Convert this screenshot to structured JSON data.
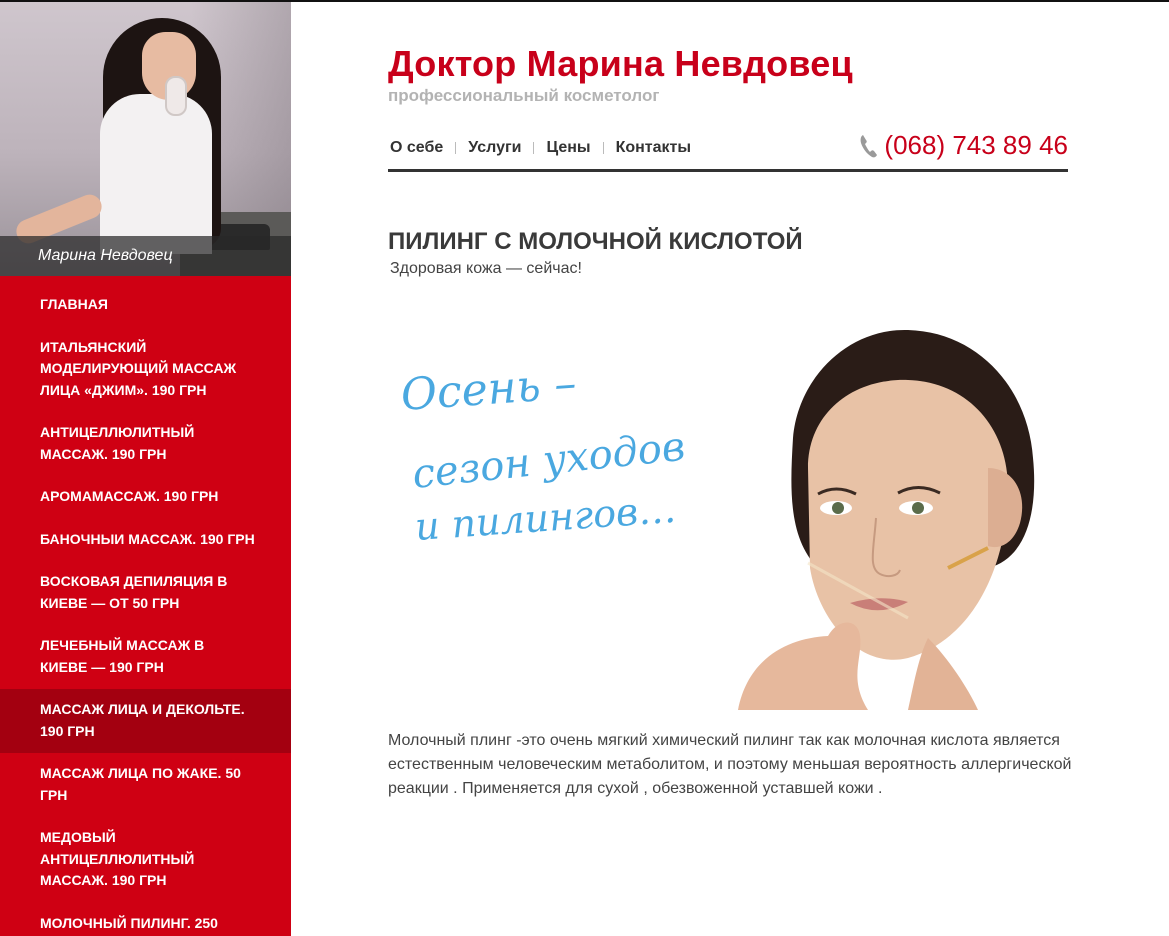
{
  "sidebar": {
    "photo_caption": "Марина Невдовец",
    "menu": [
      {
        "label": "Главная",
        "active": false
      },
      {
        "label": "Итальянский моделирующий массаж лица «Джим». 190 грн",
        "active": false
      },
      {
        "label": "Антицеллюлитный массаж. 190 грн",
        "active": false
      },
      {
        "label": "Аромамассаж. 190 грн",
        "active": false
      },
      {
        "label": "Баночныи массаж. 190 грн",
        "active": false
      },
      {
        "label": "Восковая депиляция в Киеве — от 50 грн",
        "active": false
      },
      {
        "label": "Лечебный массаж в Киеве — 190 грн",
        "active": false
      },
      {
        "label": "Массаж лица и декольте. 190 грн",
        "active": true
      },
      {
        "label": "Массаж лица по Жаке. 50 грн",
        "active": false
      },
      {
        "label": "Медовый антицеллюлитный массаж. 190 грн",
        "active": false
      },
      {
        "label": "Молочный пилинг. 250",
        "active": false
      }
    ]
  },
  "header": {
    "title": "Доктор Марина Невдовец",
    "subtitle": "профессиональный косметолог",
    "nav": [
      "О себе",
      "Услуги",
      "Цены",
      "Контакты"
    ],
    "phone": "(068) 743 89 46",
    "phone_icon": "phone-icon"
  },
  "content": {
    "title": "ПИЛИНГ С МОЛОЧНОЙ КИСЛОТОЙ",
    "subtitle": "Здоровая кожа — сейчас!",
    "hero_text_lines": [
      "Осень –",
      "сезон уходов",
      "и пилингов…"
    ],
    "body": " Молочный плинг -это очень мягкий химический пилинг так как молочная кислота является естественным человеческим метаболитом, и поэтому меньшая вероятность аллергической реакции . Применяется для сухой , обезвоженной уставшей кожи ."
  },
  "colors": {
    "brand_red": "#cf0013",
    "active_red": "#a30010",
    "title_red": "#c8001a",
    "script_blue": "#4aa8e0"
  }
}
